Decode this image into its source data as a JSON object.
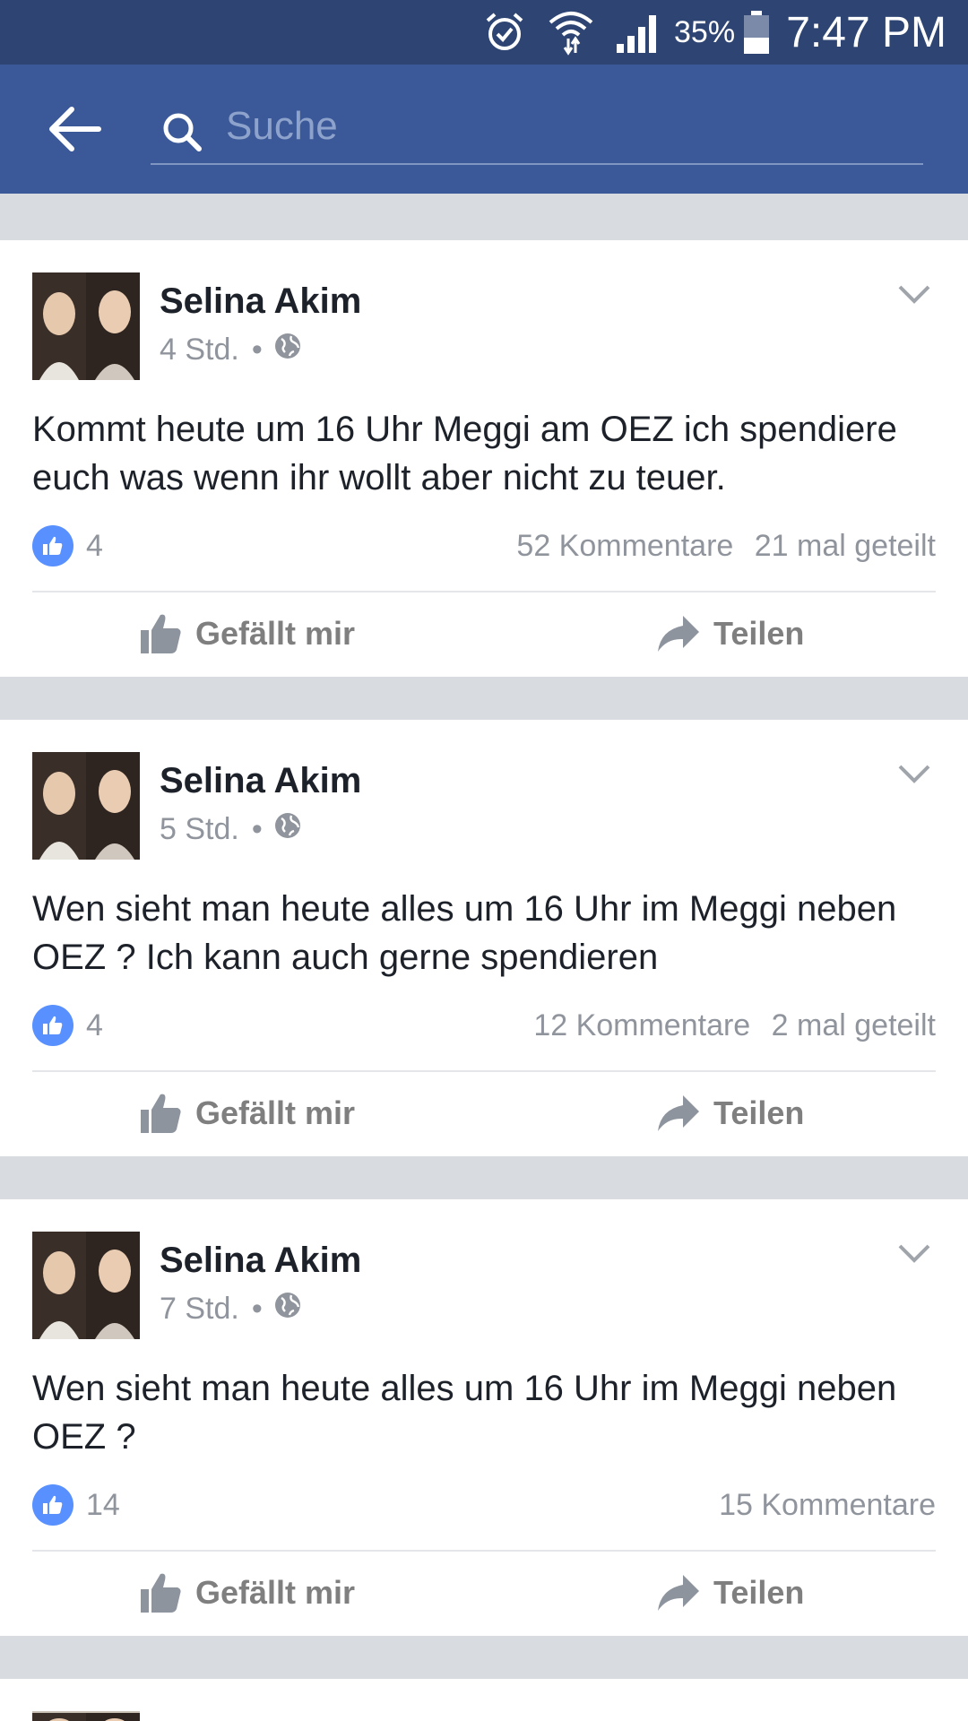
{
  "status_bar": {
    "battery_percent": "35%",
    "time": "7:47 PM",
    "icons": [
      "alarm-icon",
      "wifi-icon",
      "signal-icon",
      "battery-icon"
    ]
  },
  "search": {
    "placeholder": "Suche"
  },
  "posts": [
    {
      "author": "Selina Akim",
      "time": "4 Std.",
      "dot": "•",
      "text": "Kommt heute um 16 Uhr Meggi am OEZ ich spendiere euch was wenn ihr wollt aber nicht zu teuer.",
      "likes": "4",
      "comments": "52 Kommentare",
      "shares": "21 mal geteilt",
      "like_label": "Gefällt mir",
      "share_label": "Teilen"
    },
    {
      "author": "Selina Akim",
      "time": "5 Std.",
      "dot": "•",
      "text": "Wen sieht man heute alles um 16 Uhr im Meggi neben OEZ ? Ich kann auch gerne spendieren",
      "likes": "4",
      "comments": "12 Kommentare",
      "shares": "2 mal geteilt",
      "like_label": "Gefällt mir",
      "share_label": "Teilen"
    },
    {
      "author": "Selina Akim",
      "time": "7 Std.",
      "dot": "•",
      "text": "Wen sieht man heute alles um 16 Uhr im Meggi neben OEZ ?",
      "likes": "14",
      "comments": "15 Kommentare",
      "like_label": "Gefällt mir",
      "share_label": "Teilen"
    }
  ],
  "colors": {
    "status_bar": "#2e4573",
    "app_bar": "#3b5998",
    "like_badge": "#5890ff",
    "feed_background": "#d8dce1"
  }
}
